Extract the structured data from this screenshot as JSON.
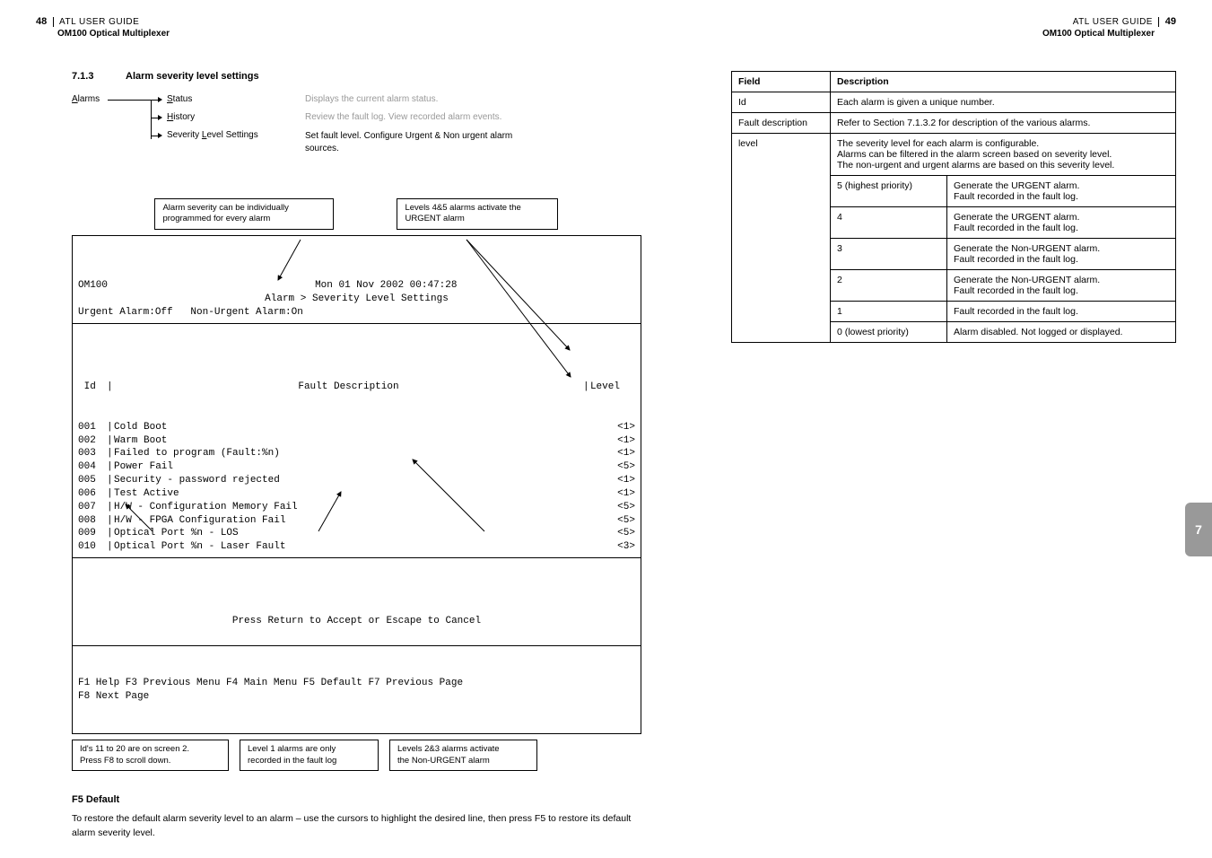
{
  "header": {
    "left_pagenum": "48",
    "right_pagenum": "49",
    "guide": "ATL USER GUIDE",
    "subtitle": "OM100 Optical Multiplexer"
  },
  "section": {
    "num": "7.1.3",
    "title": "Alarm severity level settings"
  },
  "nav": {
    "root": "Alarms",
    "root_ul": "A",
    "items": [
      {
        "label_ul": "S",
        "label": "tatus",
        "desc": "Displays the current alarm status.",
        "grey": true
      },
      {
        "label_ul": "H",
        "label": "istory",
        "desc": "Review the fault log. View recorded alarm events.",
        "grey": true
      },
      {
        "label_pre": "Severity ",
        "label_ul": "L",
        "label": "evel Settings",
        "desc": "Set fault level. Configure Urgent & Non urgent alarm sources.",
        "grey": false
      }
    ]
  },
  "annot_top": {
    "left": "Alarm severity can be individually programmed for every alarm",
    "right": "Levels 4&5 alarms activate the URGENT alarm"
  },
  "terminal": {
    "title_left": "OM100",
    "title_right": "Mon 01 Nov 2002 00:47:28",
    "menu_path": "Alarm > Severity Level Settings",
    "status": "Urgent Alarm:Off   Non-Urgent Alarm:On",
    "header_id": " Id",
    "header_desc": "Fault Description",
    "header_level": "Level",
    "rows": [
      {
        "id": "001",
        "desc": "Cold Boot",
        "level": "<1>"
      },
      {
        "id": "002",
        "desc": "Warm Boot",
        "level": "<1>"
      },
      {
        "id": "003",
        "desc": "Failed to program (Fault:%n)",
        "level": "<1>"
      },
      {
        "id": "004",
        "desc": "Power Fail",
        "level": "<5>"
      },
      {
        "id": "005",
        "desc": "Security - password rejected",
        "level": "<1>"
      },
      {
        "id": "006",
        "desc": "Test Active",
        "level": "<1>"
      },
      {
        "id": "007",
        "desc": "H/W - Configuration Memory Fail",
        "level": "<5>"
      },
      {
        "id": "008",
        "desc": "H/W - FPGA Configuration Fail",
        "level": "<5>"
      },
      {
        "id": "009",
        "desc": "Optical Port %n - LOS",
        "level": "<5>"
      },
      {
        "id": "010",
        "desc": "Optical Port %n - Laser Fault",
        "level": "<3>"
      }
    ],
    "press_return": "Press Return to Accept or Escape to Cancel",
    "footer": "F1 Help  F3 Previous Menu  F4 Main Menu  F5 Default  F7 Previous Page\nF8 Next Page"
  },
  "annot_bottom": {
    "a": "Id's 11 to 20 are on screen 2.\nPress F8 to scroll down.",
    "b": "Level 1 alarms are only\nrecorded in the fault log",
    "c": "Levels 2&3 alarms activate\nthe  Non-URGENT alarm"
  },
  "f5": {
    "head": "F5 Default",
    "body": "To restore the default alarm severity level to an alarm – use the cursors to highlight the desired line, then press F5 to restore its default alarm severity level."
  },
  "table": {
    "head_field": "Field",
    "head_desc": "Description",
    "rows": [
      {
        "field": "Id",
        "desc": "Each alarm is given a unique number."
      },
      {
        "field": "Fault description",
        "desc": "Refer to Section 7.1.3.2 for description of the various alarms."
      }
    ],
    "level_field": "level",
    "level_intro": "The severity level for each alarm is configurable.\nAlarms can be filtered in the alarm screen based on severity level.\nThe non-urgent and urgent alarms are based on this severity level.",
    "level_rows": [
      {
        "k": "5 (highest priority)",
        "v": "Generate the URGENT alarm.\nFault recorded in the fault log."
      },
      {
        "k": "4",
        "v": "Generate the URGENT alarm.\nFault recorded in the fault log."
      },
      {
        "k": "3",
        "v": "Generate the Non-URGENT alarm.\nFault recorded in the fault log."
      },
      {
        "k": "2",
        "v": "Generate the Non-URGENT alarm.\nFault recorded in the fault log."
      },
      {
        "k": "1",
        "v": "Fault recorded in the fault log."
      },
      {
        "k": "0 (lowest priority)",
        "v": "Alarm disabled. Not logged or displayed."
      }
    ]
  },
  "sidetab": "7"
}
